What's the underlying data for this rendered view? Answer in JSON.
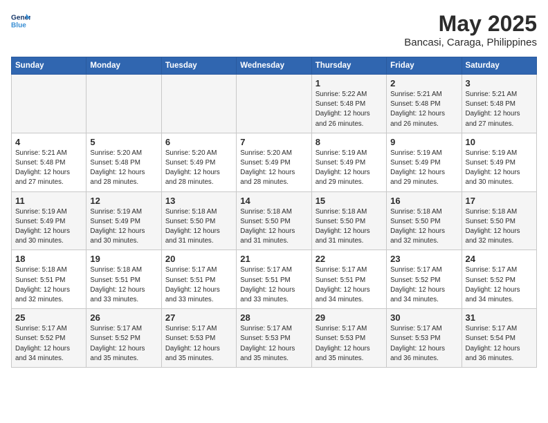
{
  "header": {
    "logo_line1": "General",
    "logo_line2": "Blue",
    "title": "May 2025",
    "subtitle": "Bancasi, Caraga, Philippines"
  },
  "days_of_week": [
    "Sunday",
    "Monday",
    "Tuesday",
    "Wednesday",
    "Thursday",
    "Friday",
    "Saturday"
  ],
  "weeks": [
    [
      {
        "day": "",
        "info": ""
      },
      {
        "day": "",
        "info": ""
      },
      {
        "day": "",
        "info": ""
      },
      {
        "day": "",
        "info": ""
      },
      {
        "day": "1",
        "info": "Sunrise: 5:22 AM\nSunset: 5:48 PM\nDaylight: 12 hours\nand 26 minutes."
      },
      {
        "day": "2",
        "info": "Sunrise: 5:21 AM\nSunset: 5:48 PM\nDaylight: 12 hours\nand 26 minutes."
      },
      {
        "day": "3",
        "info": "Sunrise: 5:21 AM\nSunset: 5:48 PM\nDaylight: 12 hours\nand 27 minutes."
      }
    ],
    [
      {
        "day": "4",
        "info": "Sunrise: 5:21 AM\nSunset: 5:48 PM\nDaylight: 12 hours\nand 27 minutes."
      },
      {
        "day": "5",
        "info": "Sunrise: 5:20 AM\nSunset: 5:48 PM\nDaylight: 12 hours\nand 28 minutes."
      },
      {
        "day": "6",
        "info": "Sunrise: 5:20 AM\nSunset: 5:49 PM\nDaylight: 12 hours\nand 28 minutes."
      },
      {
        "day": "7",
        "info": "Sunrise: 5:20 AM\nSunset: 5:49 PM\nDaylight: 12 hours\nand 28 minutes."
      },
      {
        "day": "8",
        "info": "Sunrise: 5:19 AM\nSunset: 5:49 PM\nDaylight: 12 hours\nand 29 minutes."
      },
      {
        "day": "9",
        "info": "Sunrise: 5:19 AM\nSunset: 5:49 PM\nDaylight: 12 hours\nand 29 minutes."
      },
      {
        "day": "10",
        "info": "Sunrise: 5:19 AM\nSunset: 5:49 PM\nDaylight: 12 hours\nand 30 minutes."
      }
    ],
    [
      {
        "day": "11",
        "info": "Sunrise: 5:19 AM\nSunset: 5:49 PM\nDaylight: 12 hours\nand 30 minutes."
      },
      {
        "day": "12",
        "info": "Sunrise: 5:19 AM\nSunset: 5:49 PM\nDaylight: 12 hours\nand 30 minutes."
      },
      {
        "day": "13",
        "info": "Sunrise: 5:18 AM\nSunset: 5:50 PM\nDaylight: 12 hours\nand 31 minutes."
      },
      {
        "day": "14",
        "info": "Sunrise: 5:18 AM\nSunset: 5:50 PM\nDaylight: 12 hours\nand 31 minutes."
      },
      {
        "day": "15",
        "info": "Sunrise: 5:18 AM\nSunset: 5:50 PM\nDaylight: 12 hours\nand 31 minutes."
      },
      {
        "day": "16",
        "info": "Sunrise: 5:18 AM\nSunset: 5:50 PM\nDaylight: 12 hours\nand 32 minutes."
      },
      {
        "day": "17",
        "info": "Sunrise: 5:18 AM\nSunset: 5:50 PM\nDaylight: 12 hours\nand 32 minutes."
      }
    ],
    [
      {
        "day": "18",
        "info": "Sunrise: 5:18 AM\nSunset: 5:51 PM\nDaylight: 12 hours\nand 32 minutes."
      },
      {
        "day": "19",
        "info": "Sunrise: 5:18 AM\nSunset: 5:51 PM\nDaylight: 12 hours\nand 33 minutes."
      },
      {
        "day": "20",
        "info": "Sunrise: 5:17 AM\nSunset: 5:51 PM\nDaylight: 12 hours\nand 33 minutes."
      },
      {
        "day": "21",
        "info": "Sunrise: 5:17 AM\nSunset: 5:51 PM\nDaylight: 12 hours\nand 33 minutes."
      },
      {
        "day": "22",
        "info": "Sunrise: 5:17 AM\nSunset: 5:51 PM\nDaylight: 12 hours\nand 34 minutes."
      },
      {
        "day": "23",
        "info": "Sunrise: 5:17 AM\nSunset: 5:52 PM\nDaylight: 12 hours\nand 34 minutes."
      },
      {
        "day": "24",
        "info": "Sunrise: 5:17 AM\nSunset: 5:52 PM\nDaylight: 12 hours\nand 34 minutes."
      }
    ],
    [
      {
        "day": "25",
        "info": "Sunrise: 5:17 AM\nSunset: 5:52 PM\nDaylight: 12 hours\nand 34 minutes."
      },
      {
        "day": "26",
        "info": "Sunrise: 5:17 AM\nSunset: 5:52 PM\nDaylight: 12 hours\nand 35 minutes."
      },
      {
        "day": "27",
        "info": "Sunrise: 5:17 AM\nSunset: 5:53 PM\nDaylight: 12 hours\nand 35 minutes."
      },
      {
        "day": "28",
        "info": "Sunrise: 5:17 AM\nSunset: 5:53 PM\nDaylight: 12 hours\nand 35 minutes."
      },
      {
        "day": "29",
        "info": "Sunrise: 5:17 AM\nSunset: 5:53 PM\nDaylight: 12 hours\nand 35 minutes."
      },
      {
        "day": "30",
        "info": "Sunrise: 5:17 AM\nSunset: 5:53 PM\nDaylight: 12 hours\nand 36 minutes."
      },
      {
        "day": "31",
        "info": "Sunrise: 5:17 AM\nSunset: 5:54 PM\nDaylight: 12 hours\nand 36 minutes."
      }
    ]
  ]
}
